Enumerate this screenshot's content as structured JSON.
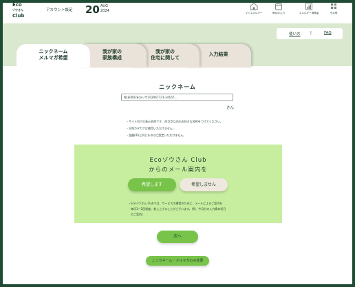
{
  "header": {
    "logo": [
      "Eco",
      "ゾウさん",
      "Club"
    ],
    "account_label": "アカウント設定",
    "date_day": "20",
    "date_month": "AUG",
    "date_year": "2024",
    "nav": [
      {
        "label": "マイエネルギー",
        "icon": "house-icon"
      },
      {
        "label": "毎月の入力",
        "icon": "calendar-icon"
      },
      {
        "label": "エネルギー消費量",
        "icon": "chart-icon"
      },
      {
        "label": "その他",
        "icon": "grid-icon"
      }
    ]
  },
  "links": {
    "usage": "使い方",
    "separator": "|",
    "faq": "FAQ"
  },
  "tabs": [
    {
      "line1": "ニックネーム",
      "line2": "メルマガ希望",
      "active": true
    },
    {
      "line1": "我が家の",
      "line2": "家族構成",
      "active": false
    },
    {
      "line1": "我が家の",
      "line2": "住宅に関して",
      "active": false
    },
    {
      "line1": "入力結果",
      "line2": "",
      "active": false
    }
  ],
  "form": {
    "title": "ニックネーム",
    "nickname_value": "NLE0002Ecoゾウ202067721-24167...",
    "suffix": "さん",
    "notes": [
      "・サイト内での表示名称です。24文字以内のお好きな名称をつけてください。",
      "・半角カタカナは使用いただけません。",
      "・金額(ID)と同じものはご設定いただけません。"
    ]
  },
  "mail": {
    "title_line1": "Ecoゾウさん Club",
    "title_line2": "からのメール案内を",
    "accept_label": "希望します",
    "decline_label": "希望しません",
    "note_lines": [
      "・Ecoゾウさん Clubでは、サービスの運営のために、メールによるご案内を",
      "　毎月1～2回程度、差し上げることがございます。(例、今月分の入力締め切日",
      "　のご案内)"
    ]
  },
  "actions": {
    "next_label": "次へ",
    "change_label": "ニックネーム・メルマガのみ変更"
  },
  "colors": {
    "brand_dark": "#1f4a33",
    "band": "#d9e8cf",
    "panel": "#c7ee9f",
    "button_green": "#78c34a",
    "tab_inactive": "#e9e3d9"
  }
}
